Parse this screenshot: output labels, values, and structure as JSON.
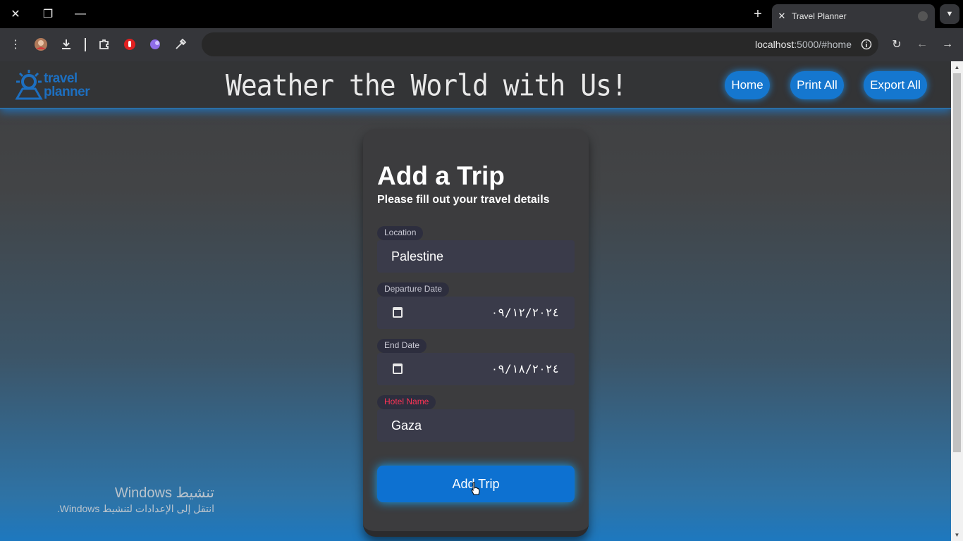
{
  "browser": {
    "tab_title": "Travel Planner",
    "url_host": "localhost",
    "url_path": ":5000/#home",
    "icons": [
      "close-icon",
      "restore-icon",
      "minimize-icon",
      "new-tab-icon",
      "tab-search-icon",
      "menu-icon",
      "profile-avatar",
      "download-icon",
      "extensions-icon",
      "red-hand-extension",
      "purple-extension",
      "eyedropper-icon",
      "bookmark-star-icon",
      "site-info-icon",
      "reload-icon",
      "back-icon",
      "forward-icon"
    ]
  },
  "header": {
    "logo_line1": "travel",
    "logo_line2": "planner",
    "headline": "Weather the World with Us!",
    "nav": {
      "home": "Home",
      "print_all": "Print All",
      "export_all": "Export All"
    }
  },
  "form": {
    "title": "Add a Trip",
    "subtitle": "Please fill out your travel details",
    "location": {
      "label": "Location",
      "value": "Palestine"
    },
    "departure": {
      "label": "Departure Date",
      "value": "٠٩/١٢/٢٠٢٤"
    },
    "end": {
      "label": "End Date",
      "value": "٠٩/١٨/٢٠٢٤"
    },
    "hotel": {
      "label": "Hotel Name",
      "value": "Gaza"
    },
    "submit": "Add Trip"
  },
  "watermark": {
    "line1": "تنشيط Windows",
    "line2": "انتقل إلى الإعدادات لتنشيط Windows."
  },
  "colors": {
    "accent": "#1577cf",
    "required_label": "#ff3355",
    "card": "#3c3c3e"
  }
}
